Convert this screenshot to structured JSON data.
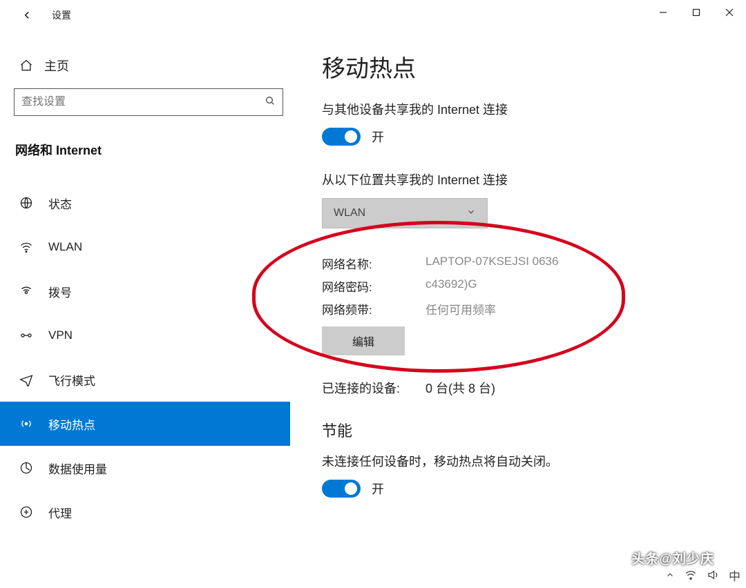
{
  "window": {
    "title": "设置"
  },
  "sidebar": {
    "home": "主页",
    "search_placeholder": "查找设置",
    "section": "网络和 Internet",
    "items": [
      {
        "label": "状态",
        "icon": "globe"
      },
      {
        "label": "WLAN",
        "icon": "wifi"
      },
      {
        "label": "拨号",
        "icon": "dial"
      },
      {
        "label": "VPN",
        "icon": "vpn"
      },
      {
        "label": "飞行模式",
        "icon": "airplane"
      },
      {
        "label": "移动热点",
        "icon": "hotspot",
        "active": true
      },
      {
        "label": "数据使用量",
        "icon": "data"
      },
      {
        "label": "代理",
        "icon": "proxy"
      }
    ]
  },
  "main": {
    "title": "移动热点",
    "share_text": "与其他设备共享我的 Internet 连接",
    "toggle1_state": "开",
    "share_from_label": "从以下位置共享我的 Internet 连接",
    "share_from_value": "WLAN",
    "network": {
      "name_label": "网络名称:",
      "name_value": "LAPTOP-07KSEJSI 0636",
      "pass_label": "网络密码:",
      "pass_value": "c43692)G",
      "band_label": "网络频带:",
      "band_value": "任何可用频率"
    },
    "edit_button": "编辑",
    "devices_label": "已连接的设备:",
    "devices_value": "0 台(共 8 台)",
    "power_title": "节能",
    "power_desc": "未连接任何设备时，移动热点将自动关闭。",
    "toggle2_state": "开"
  },
  "watermark": "头条@刘少庆",
  "tray": {
    "ime": "中"
  }
}
